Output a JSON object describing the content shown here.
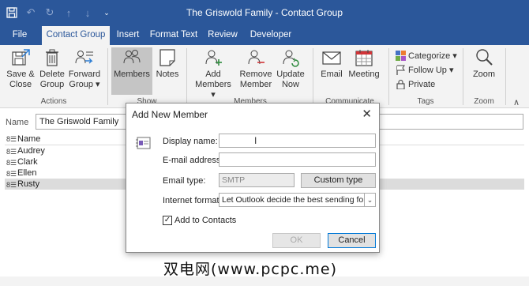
{
  "window": {
    "title": "The Griswold Family  -  Contact Group"
  },
  "tabs": [
    "File",
    "Contact Group",
    "Insert",
    "Format Text",
    "Review",
    "Developer"
  ],
  "ribbon": {
    "actions": {
      "save_close_1": "Save &",
      "save_close_2": "Close",
      "delete_1": "Delete",
      "delete_2": "Group",
      "forward_1": "Forward",
      "forward_2": "Group ▾",
      "group": "Actions"
    },
    "show": {
      "members": "Members",
      "notes": "Notes",
      "group": "Show"
    },
    "members": {
      "add_1": "Add",
      "add_2": "Members ▾",
      "remove_1": "Remove",
      "remove_2": "Member",
      "update_1": "Update",
      "update_2": "Now",
      "group": "Members"
    },
    "communicate": {
      "email": "Email",
      "meeting": "Meeting",
      "group": "Communicate"
    },
    "tags": {
      "categorize": "Categorize ▾",
      "follow_up": "Follow Up ▾",
      "private": "Private",
      "group": "Tags"
    },
    "zoom": {
      "zoom": "Zoom",
      "group": "Zoom"
    }
  },
  "name_field": {
    "label": "Name",
    "value": "The Griswold Family"
  },
  "list": {
    "header": "Name",
    "rows": [
      "Audrey",
      "Clark",
      "Ellen",
      "Rusty"
    ]
  },
  "dialog": {
    "title": "Add New Member",
    "display_name_label": "Display name:",
    "display_name_value": "",
    "email_label": "E-mail address:",
    "email_value": "",
    "email_type_label": "Email type:",
    "email_type_value": "SMTP",
    "custom_type": "Custom type",
    "internet_format_label": "Internet format:",
    "internet_format_value": "Let Outlook decide the best sending format",
    "add_to_contacts": "Add to Contacts",
    "ok": "OK",
    "cancel": "Cancel"
  },
  "watermark": "双电网(www.pcpc.me)",
  "colors": {
    "brand": "#2b579a",
    "ribbon_bg": "#f3f3f3",
    "selected": "#c5c5c5",
    "accent_blue": "#0078d7"
  }
}
